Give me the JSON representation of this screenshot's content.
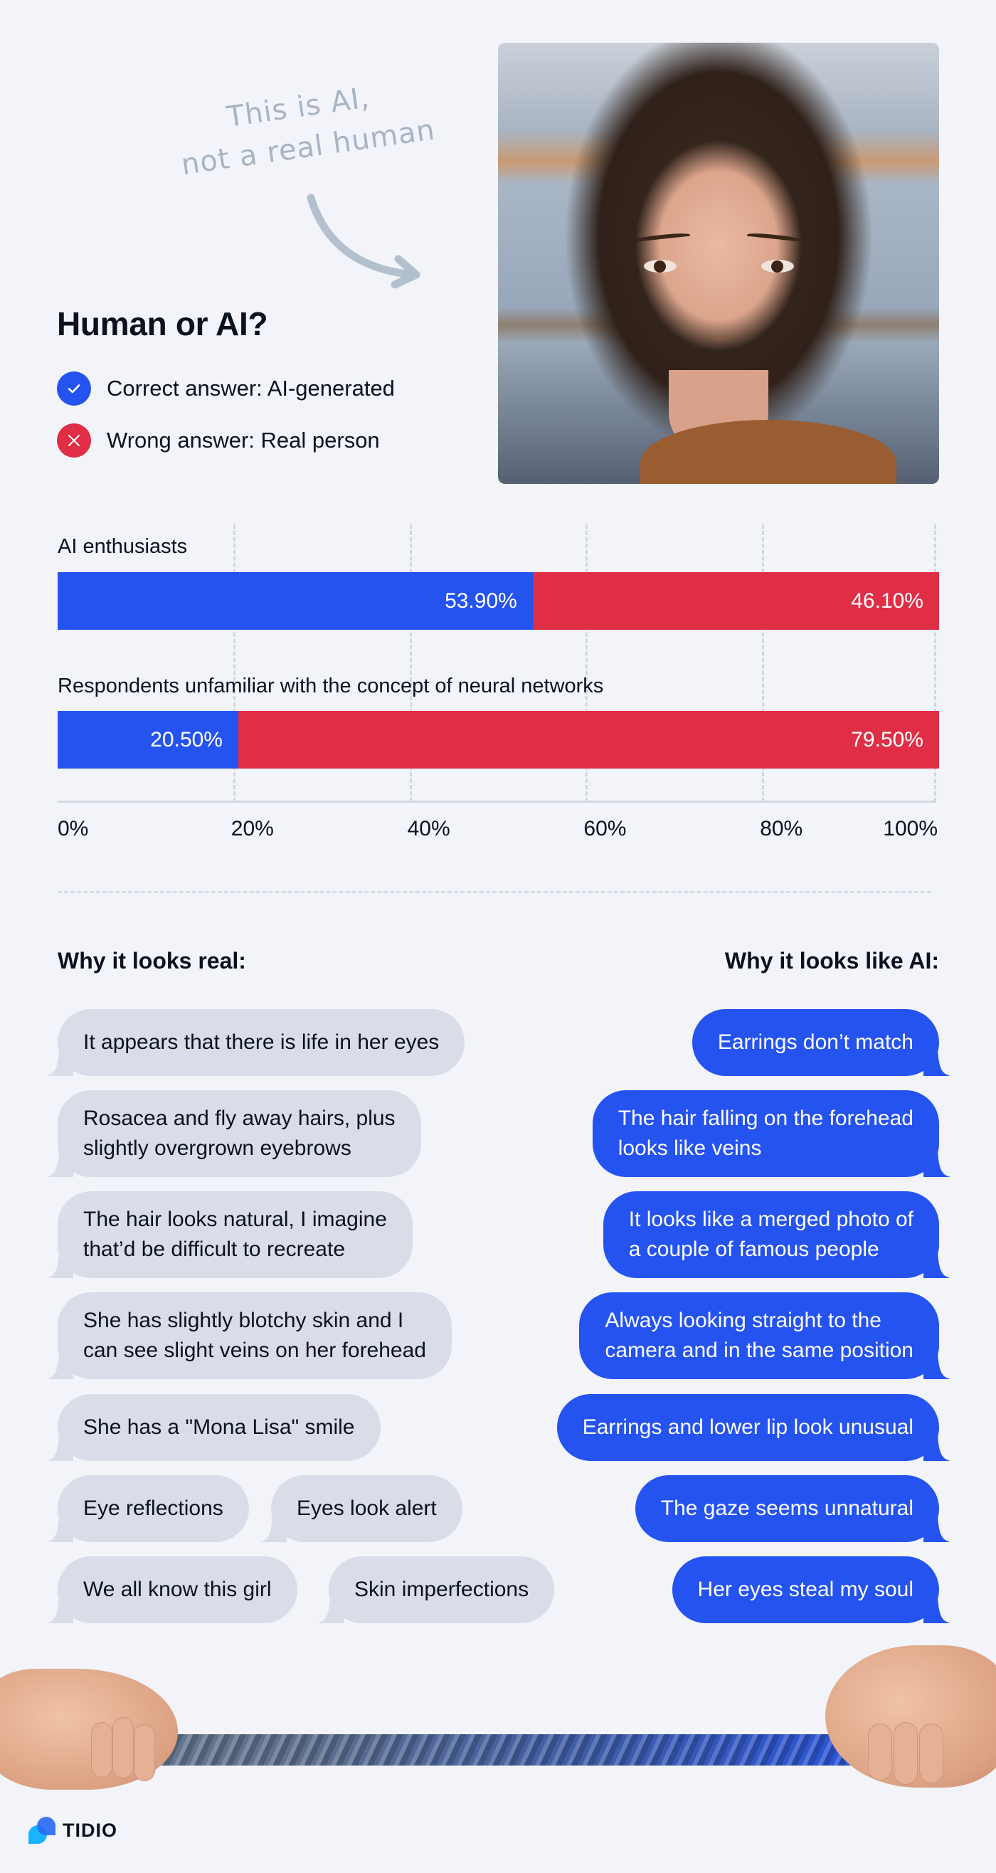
{
  "annotation": {
    "line1": "This is AI,",
    "line2": "not a real human",
    "arrow_icon": "curved-arrow-icon"
  },
  "header": {
    "title": "Human or AI?"
  },
  "legend": [
    {
      "icon": "check-icon",
      "label": "Correct answer: AI-generated",
      "color": "#2553f0"
    },
    {
      "icon": "close-icon",
      "label": "Wrong answer: Real person",
      "color": "#df2e46"
    }
  ],
  "photo": {
    "alt": "Portrait of AI-generated woman"
  },
  "colors": {
    "correct": "#2553f0",
    "wrong": "#df2e46",
    "bubble_gray": "#d9dde8",
    "background": "#f2f4fa"
  },
  "chart_data": {
    "type": "bar",
    "orientation": "horizontal",
    "stacked": true,
    "categories": [
      "AI enthusiasts",
      "Respondents unfamiliar with the concept of neural networks"
    ],
    "series": [
      {
        "name": "Correct answer: AI-generated",
        "values": [
          53.9,
          20.5
        ],
        "labels": [
          "53.90%",
          "20.50%"
        ]
      },
      {
        "name": "Wrong answer: Real person",
        "values": [
          46.1,
          79.5
        ],
        "labels": [
          "46.10%",
          "79.50%"
        ]
      }
    ],
    "xlim": [
      0,
      100
    ],
    "xticks": [
      0,
      20,
      40,
      60,
      80,
      100
    ],
    "xtick_labels": [
      "0%",
      "20%",
      "40%",
      "60%",
      "80%",
      "100%"
    ],
    "grid": true,
    "title": "",
    "xlabel": "",
    "ylabel": ""
  },
  "sections": {
    "real": {
      "heading": "Why it looks real:",
      "bubbles": [
        [
          "It appears that there is life in her eyes"
        ],
        [
          "Rosacea and fly away hairs, plus",
          "slightly overgrown eyebrows"
        ],
        [
          "The hair looks natural, I imagine",
          "that’d be difficult to recreate"
        ],
        [
          "She has slightly blotchy skin and I",
          "can see slight veins on her forehead"
        ],
        [
          "She has a \"Mona Lisa\" smile"
        ],
        [
          "Eye reflections"
        ],
        [
          "Eyes look alert"
        ],
        [
          "We all know this girl"
        ],
        [
          "Skin imperfections"
        ]
      ]
    },
    "ai": {
      "heading": "Why it looks like AI:",
      "bubbles": [
        [
          "Earrings don’t match"
        ],
        [
          "The hair falling on the forehead",
          "looks like veins"
        ],
        [
          "It looks like a merged photo of",
          "a couple of famous people"
        ],
        [
          "Always looking straight to the",
          "camera and in the same position"
        ],
        [
          "Earrings and lower lip look unusual"
        ],
        [
          "The gaze seems unnatural"
        ],
        [
          "Her eyes steal my soul"
        ]
      ]
    }
  },
  "footer": {
    "image": "tug-of-war-rope-hands",
    "logo_text": "TIDIO",
    "logo_icon": "tidio-logo-icon"
  }
}
